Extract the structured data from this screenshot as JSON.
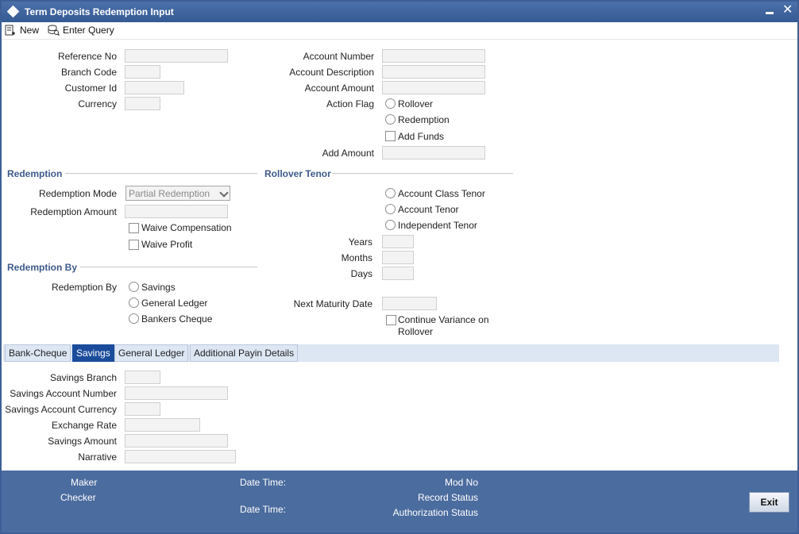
{
  "window": {
    "title": "Term Deposits Redemption Input"
  },
  "toolbar": {
    "new_label": "New",
    "enter_query_label": "Enter Query"
  },
  "header": {
    "reference_no_label": "Reference No",
    "branch_code_label": "Branch Code",
    "customer_id_label": "Customer Id",
    "currency_label": "Currency",
    "account_number_label": "Account Number",
    "account_description_label": "Account Description",
    "account_amount_label": "Account Amount",
    "action_flag_label": "Action Flag",
    "rollover_label": "Rollover",
    "redemption_label": "Redemption",
    "add_funds_label": "Add Funds",
    "add_amount_label": "Add Amount"
  },
  "redemption": {
    "section_title": "Redemption",
    "mode_label": "Redemption Mode",
    "mode_value": "Partial Redemption",
    "amount_label": "Redemption Amount",
    "waive_compensation_label": "Waive Compensation",
    "waive_profit_label": "Waive Profit"
  },
  "rollover_tenor": {
    "section_title": "Rollover Tenor",
    "account_class_tenor_label": "Account Class Tenor",
    "account_tenor_label": "Account Tenor",
    "independent_tenor_label": "Independent Tenor",
    "years_label": "Years",
    "months_label": "Months",
    "days_label": "Days",
    "next_maturity_date_label": "Next Maturity Date",
    "continue_variance_label_1": "Continue Variance on",
    "continue_variance_label_2": "Rollover"
  },
  "redemption_by": {
    "section_title": "Redemption By",
    "label": "Redemption By",
    "savings_label": "Savings",
    "general_ledger_label": "General Ledger",
    "bankers_cheque_label": "Bankers Cheque"
  },
  "tabs": [
    {
      "label": "Bank-Cheque"
    },
    {
      "label": "Savings"
    },
    {
      "label": "General Ledger"
    },
    {
      "label": "Additional Payin Details"
    }
  ],
  "savings_tab": {
    "branch_label": "Savings Branch",
    "account_number_label": "Savings Account Number",
    "account_currency_label": "Savings Account Currency",
    "exchange_rate_label": "Exchange Rate",
    "amount_label": "Savings Amount",
    "narrative_label": "Narrative"
  },
  "footer": {
    "maker_label": "Maker",
    "checker_label": "Checker",
    "date_time_label_1": "Date Time:",
    "date_time_label_2": "Date Time:",
    "mod_no_label": "Mod No",
    "record_status_label": "Record Status",
    "authorization_status_label": "Authorization Status",
    "exit_label": "Exit"
  },
  "colors": {
    "titlebar": "#3d5f96",
    "section_title": "#3d5a8a",
    "active_tab": "#1b4c9c",
    "footer": "#4b6c9f"
  }
}
